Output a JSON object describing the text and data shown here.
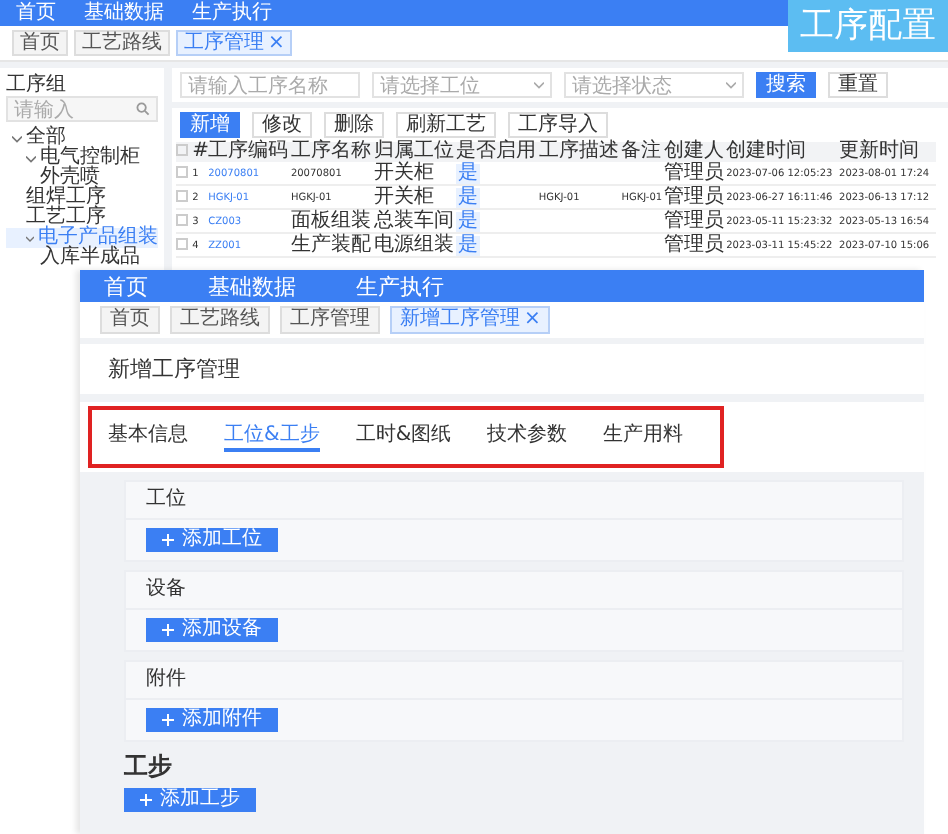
{
  "caption": "工序配置",
  "background_window": {
    "nav": [
      "首页",
      "基础数据",
      "生产执行"
    ],
    "tags": [
      {
        "label": "首页",
        "selected": false
      },
      {
        "label": "工艺路线",
        "selected": false
      },
      {
        "label": "工序管理",
        "selected": true,
        "close": "×"
      }
    ],
    "sidebar": {
      "title": "工序组",
      "search_placeholder": "请输入",
      "tree": [
        {
          "label": "全部",
          "selected": false,
          "expanded": true,
          "children": [
            {
              "label": "电气控制柜",
              "selected": false,
              "expanded": true,
              "children": [
                {
                  "label": "外壳喷",
                  "selected": false
                }
              ]
            },
            {
              "label": "组焊工序",
              "selected": false
            },
            {
              "label": "工艺工序",
              "selected": false
            },
            {
              "label": "电子产品组装",
              "selected": true,
              "expanded": true,
              "children": [
                {
                  "label": "入库半成品",
                  "selected": false
                }
              ]
            }
          ]
        }
      ]
    },
    "filters": [
      {
        "kind": "input",
        "placeholder": "请输入工序名称"
      },
      {
        "kind": "select",
        "placeholder": "请选择工位"
      },
      {
        "kind": "select",
        "placeholder": "请选择状态"
      }
    ],
    "filter_buttons": [
      {
        "kind": "primary",
        "label": "搜索"
      },
      {
        "kind": "plain",
        "label": "重置"
      }
    ],
    "toolbar": [
      {
        "kind": "primary",
        "label": "新增"
      },
      {
        "kind": "plain",
        "label": "修改"
      },
      {
        "kind": "plain",
        "label": "删除"
      },
      {
        "kind": "plain",
        "label": "刷新工艺"
      },
      {
        "kind": "plain",
        "label": "工序导入"
      }
    ],
    "table": {
      "all_checked": false,
      "columns": [
        "#",
        "工序编码",
        "工序名称",
        "归属工位",
        "是否启用",
        "工序描述",
        "备注",
        "创建人",
        "创建时间",
        "更新时间"
      ],
      "rows": [
        {
          "checked": false,
          "cells": [
            "1",
            "20070801",
            "20070801",
            "开关柜",
            "是",
            "",
            "",
            "管理员",
            "2023-07-06 12:05:23",
            "2023-08-01 17:24"
          ]
        },
        {
          "checked": false,
          "cells": [
            "2",
            "HGKJ-01",
            "HGKJ-01",
            "开关柜",
            "是",
            "HGKJ-01",
            "HGKJ-01",
            "管理员",
            "2023-06-27 16:11:46",
            "2023-06-13 17:12"
          ]
        },
        {
          "checked": false,
          "cells": [
            "3",
            "CZ003",
            "面板组装",
            "总装车间",
            "是",
            "",
            "",
            "管理员",
            "2023-05-11 15:23:32",
            "2023-05-13 16:54"
          ]
        },
        {
          "checked": false,
          "cells": [
            "4",
            "ZZ001",
            "生产装配",
            "电源组装",
            "是",
            "",
            "",
            "管理员",
            "2023-03-11 15:45:22",
            "2023-07-10 15:06"
          ]
        }
      ]
    }
  },
  "form_window": {
    "nav": [
      "首页",
      "基础数据",
      "生产执行"
    ],
    "tags": [
      {
        "label": "首页",
        "selected": false
      },
      {
        "label": "工艺路线",
        "selected": false
      },
      {
        "label": "工序管理",
        "selected": false
      },
      {
        "label": "新增工序管理",
        "selected": true,
        "close": "×"
      }
    ],
    "page_title": "新增工序管理",
    "tabs": [
      {
        "label": "基本信息",
        "selected": false
      },
      {
        "label": "工位&工步",
        "selected": true
      },
      {
        "label": "工时&图纸",
        "selected": false
      },
      {
        "label": "技术参数",
        "selected": false
      },
      {
        "label": "生产用料",
        "selected": false
      }
    ],
    "sections": [
      {
        "label": "工位",
        "button": "添加工位"
      },
      {
        "label": "设备",
        "button": "添加设备"
      },
      {
        "label": "附件",
        "button": "添加附件"
      }
    ],
    "step": {
      "label": "工步",
      "button": "添加工步"
    }
  }
}
